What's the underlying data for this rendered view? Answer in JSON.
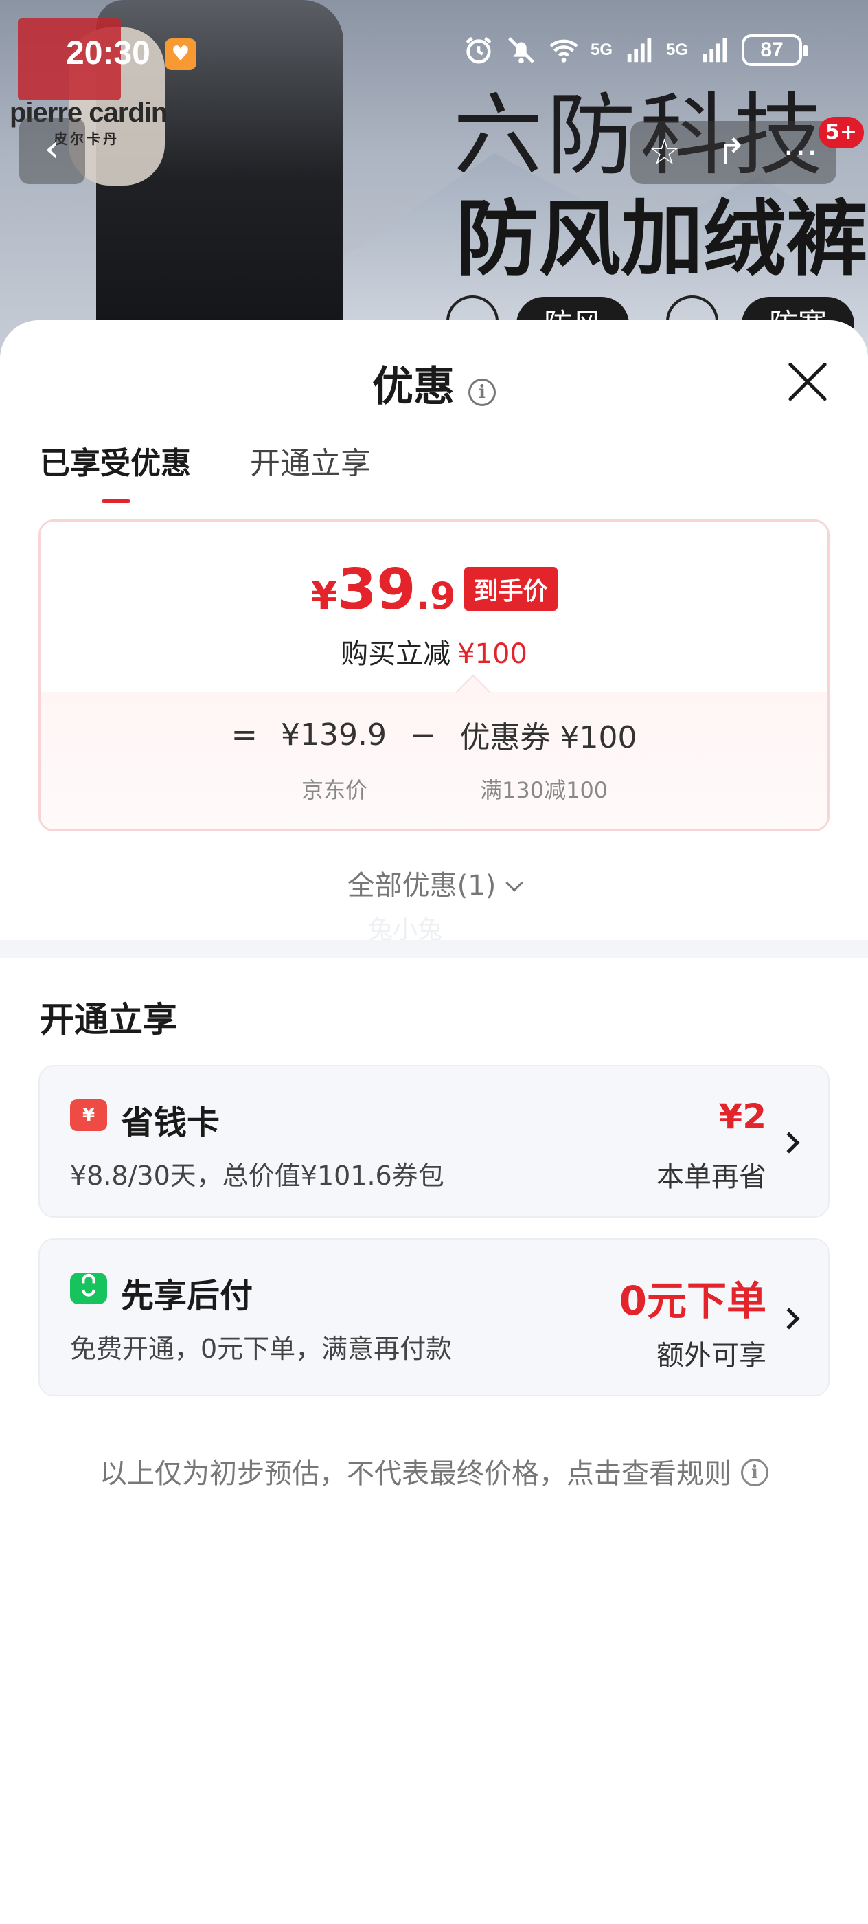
{
  "status_bar": {
    "time": "20:30",
    "network_1": "5G",
    "network_2": "5G",
    "battery": "87"
  },
  "banner": {
    "brand": "pierre cardin",
    "brand_sub": "皮尔卡丹",
    "headline_1": "六防科技",
    "headline_2": "防风加绒裤",
    "pill_1": "防风",
    "pill_2": "防寒",
    "badge_count": "5+"
  },
  "sheet": {
    "title": "优惠",
    "tabs": [
      {
        "label": "已享受优惠",
        "active": true
      },
      {
        "label": "开通立享",
        "active": false
      }
    ],
    "price_card": {
      "final_price_symbol": "¥",
      "final_price_int": "39",
      "final_price_dec": ".9",
      "final_tag": "到手价",
      "reduce_label": "购买立减",
      "reduce_amount": "¥100",
      "equals": "=",
      "jd_price": "¥139.9",
      "minus": "−",
      "coupon": "优惠券 ¥100",
      "jd_price_label": "京东价",
      "coupon_rule": "满130减100"
    },
    "all_offers": "全部优惠(1)",
    "watermark": "兔小兔",
    "open_section_title": "开通立享",
    "offers": [
      {
        "title": "省钱卡",
        "icon": "yuan-ticket-icon",
        "icon_text": "¥",
        "description": "¥8.8/30天，总价值¥101.6券包",
        "value": "¥2",
        "sub": "本单再省"
      },
      {
        "title": "先享后付",
        "icon": "shopping-bag-icon",
        "description": "免费开通，0元下单，满意再付款",
        "value": "0元下单",
        "sub": "额外可享"
      }
    ],
    "disclaimer": "以上仅为初步预估，不代表最终价格，点击查看规则"
  },
  "colors": {
    "accent_red": "#e3242b",
    "green_icon": "#17c35c",
    "card_bg": "#f6f7fb"
  }
}
